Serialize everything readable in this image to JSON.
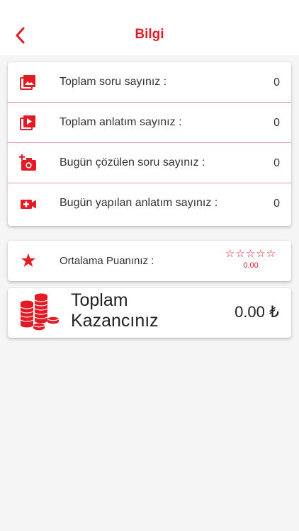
{
  "header": {
    "title": "Bilgi",
    "back_icon": "chevron-left-icon"
  },
  "stats": [
    {
      "icon": "image-icon",
      "label": "Toplam soru sayınız :",
      "value": "0"
    },
    {
      "icon": "video-play-icon",
      "label": "Toplam anlatım sayınız :",
      "value": "0"
    },
    {
      "icon": "add-camera-icon",
      "label": "Bugün çözülen soru sayınız :",
      "value": "0"
    },
    {
      "icon": "video-camera-plus-icon",
      "label": "Bugün yapılan anlatım sayınız :",
      "value": "0"
    }
  ],
  "rating": {
    "icon": "star-icon",
    "label": "Ortalama Puanınız :",
    "stars": "☆☆☆☆☆",
    "value": "0.00",
    "stars_filled": 0,
    "stars_total": 5
  },
  "earnings": {
    "icon": "coins-icon",
    "label_line1": "Toplam",
    "label_line2": "Kazancınız",
    "value": "0.00 ₺"
  },
  "colors": {
    "accent": "#e21b25",
    "separator": "#e99aa0",
    "background": "#f5f5f5",
    "card": "#ffffff",
    "text": "#333333"
  }
}
